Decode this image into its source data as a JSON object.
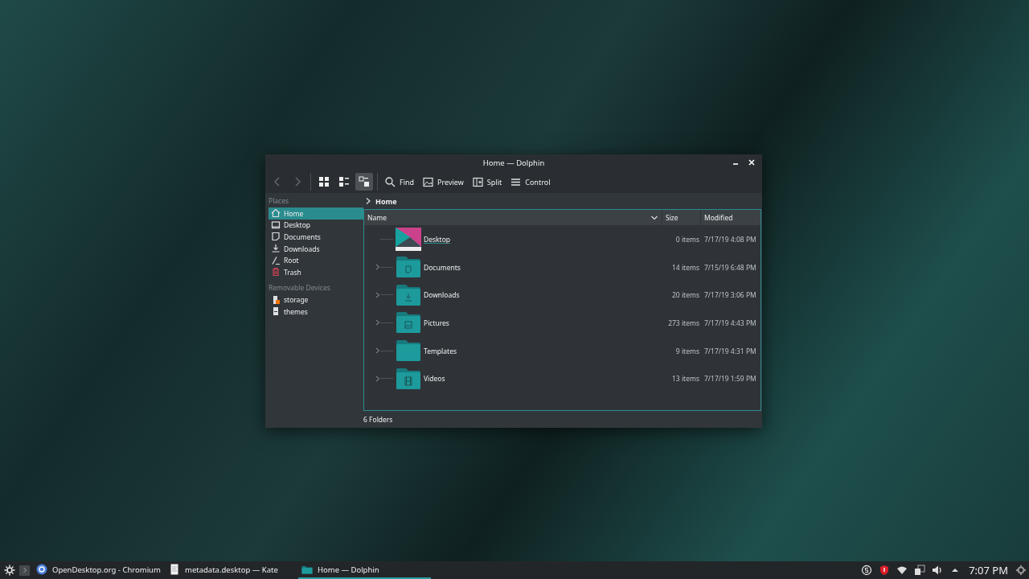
{
  "window": {
    "title": "Home — Dolphin"
  },
  "toolbar": {
    "view_modes": [
      {
        "kind": "icons",
        "selected": false
      },
      {
        "kind": "compact",
        "selected": false
      },
      {
        "kind": "details",
        "selected": true
      }
    ],
    "actions": [
      {
        "kind": "find",
        "label": "Find"
      },
      {
        "kind": "preview",
        "label": "Preview"
      },
      {
        "kind": "split",
        "label": "Split"
      },
      {
        "kind": "control",
        "label": "Control"
      }
    ]
  },
  "places": {
    "heading": "Places",
    "items": [
      {
        "kind": "home",
        "label": "Home",
        "selected": true
      },
      {
        "kind": "desktop",
        "label": "Desktop",
        "selected": false
      },
      {
        "kind": "documents",
        "label": "Documents",
        "selected": false
      },
      {
        "kind": "downloads",
        "label": "Downloads",
        "selected": false
      },
      {
        "kind": "root",
        "label": "Root",
        "selected": false
      },
      {
        "kind": "trash",
        "label": "Trash",
        "selected": false
      }
    ]
  },
  "devices": {
    "heading": "Removable Devices",
    "items": [
      {
        "kind": "mounted",
        "label": "storage",
        "selected": false
      },
      {
        "kind": "drive",
        "label": "themes",
        "selected": false
      }
    ]
  },
  "breadcrumb": [
    "Home"
  ],
  "table": {
    "columns": [
      "Name",
      "Size",
      "Modified"
    ],
    "rows": [
      {
        "kind": "desktop",
        "name": "Desktop",
        "size": "0 items",
        "modified": "7/17/19 4:08 PM",
        "expandable": false,
        "hovered": true
      },
      {
        "kind": "documents",
        "name": "Documents",
        "size": "14 items",
        "modified": "7/15/19 6:48 PM",
        "expandable": true,
        "hovered": false
      },
      {
        "kind": "downloads",
        "name": "Downloads",
        "size": "20 items",
        "modified": "7/17/19 3:06 PM",
        "expandable": true,
        "hovered": false
      },
      {
        "kind": "pictures",
        "name": "Pictures",
        "size": "273 items",
        "modified": "7/17/19 4:43 PM",
        "expandable": true,
        "hovered": false
      },
      {
        "kind": "templates",
        "name": "Templates",
        "size": "9 items",
        "modified": "7/17/19 4:31 PM",
        "expandable": true,
        "hovered": false
      },
      {
        "kind": "videos",
        "name": "Videos",
        "size": "13 items",
        "modified": "7/17/19 1:59 PM",
        "expandable": true,
        "hovered": false
      }
    ]
  },
  "status_bar": "6 Folders",
  "taskbar": {
    "tasks": [
      {
        "kind": "browser",
        "label": "OpenDesktop.org - Chromium",
        "active": false
      },
      {
        "kind": "editor",
        "label": "metadata.desktop  — Kate",
        "active": false
      },
      {
        "kind": "files",
        "label": "Home — Dolphin",
        "active": true
      }
    ],
    "tray": [
      {
        "kind": "clipboard"
      },
      {
        "kind": "security"
      },
      {
        "kind": "wifi"
      },
      {
        "kind": "devices"
      },
      {
        "kind": "volume"
      },
      {
        "kind": "expand"
      }
    ],
    "clock": "7:07 PM"
  }
}
